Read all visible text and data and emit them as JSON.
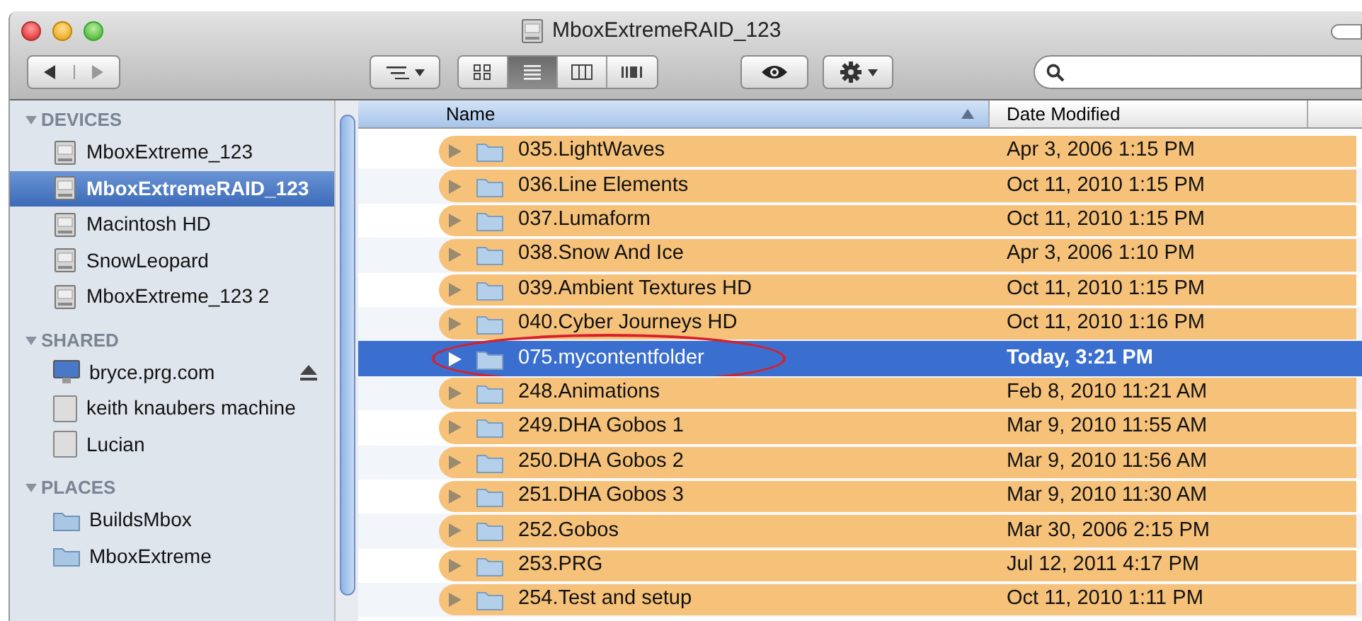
{
  "window": {
    "title": "MboxExtremeRAID_123"
  },
  "toolbar": {
    "view_modes": [
      {
        "kind": "icons",
        "selected": false
      },
      {
        "kind": "list",
        "selected": true
      },
      {
        "kind": "columns",
        "selected": false
      },
      {
        "kind": "coverflow",
        "selected": false
      }
    ]
  },
  "sidebar": {
    "sections": [
      {
        "title": "DEVICES",
        "expanded": true,
        "items": [
          {
            "label": "MboxExtreme_123",
            "kind": "drive",
            "selected": false,
            "eject": false
          },
          {
            "label": "MboxExtremeRAID_123",
            "kind": "drive",
            "selected": true,
            "eject": false
          },
          {
            "label": "Macintosh HD",
            "kind": "drive",
            "selected": false,
            "eject": false
          },
          {
            "label": "SnowLeopard",
            "kind": "drive",
            "selected": false,
            "eject": false
          },
          {
            "label": "MboxExtreme_123 2",
            "kind": "drive",
            "selected": false,
            "eject": false
          }
        ]
      },
      {
        "title": "SHARED",
        "expanded": true,
        "items": [
          {
            "label": "bryce.prg.com",
            "kind": "display",
            "selected": false,
            "eject": true
          },
          {
            "label": "keith knaubers machine",
            "kind": "computer",
            "selected": false,
            "eject": false
          },
          {
            "label": "Lucian",
            "kind": "computer",
            "selected": false,
            "eject": false
          }
        ]
      },
      {
        "title": "PLACES",
        "expanded": true,
        "items": [
          {
            "label": "BuildsMbox",
            "kind": "folder",
            "selected": false,
            "eject": false
          },
          {
            "label": "MboxExtreme",
            "kind": "folder",
            "selected": false,
            "eject": false
          }
        ]
      }
    ]
  },
  "table": {
    "columns": [
      {
        "label": "Name",
        "sorted": true
      },
      {
        "label": "Date Modified",
        "sorted": false
      }
    ],
    "rows": [
      {
        "name": "035.LightWaves",
        "date": "Apr 3, 2006 1:15 PM",
        "selected": false,
        "circled": false,
        "color": "#f6c27a"
      },
      {
        "name": "036.Line Elements",
        "date": "Oct 11, 2010 1:15 PM",
        "selected": false,
        "circled": false,
        "color": "#f6c27a"
      },
      {
        "name": "037.Lumaform",
        "date": "Oct 11, 2010 1:15 PM",
        "selected": false,
        "circled": false,
        "color": "#f6c27a"
      },
      {
        "name": "038.Snow And Ice",
        "date": "Apr 3, 2006 1:10 PM",
        "selected": false,
        "circled": false,
        "color": "#f6c27a"
      },
      {
        "name": "039.Ambient Textures HD",
        "date": "Oct 11, 2010 1:15 PM",
        "selected": false,
        "circled": false,
        "color": "#f6c27a"
      },
      {
        "name": "040.Cyber Journeys HD",
        "date": "Oct 11, 2010 1:16 PM",
        "selected": false,
        "circled": false,
        "color": "#f6c27a"
      },
      {
        "name": "075.mycontentfolder",
        "date": "Today, 3:21 PM",
        "selected": true,
        "circled": true
      },
      {
        "name": "248.Animations",
        "date": "Feb 8, 2010 11:21 AM",
        "selected": false,
        "circled": false,
        "color": "#f6c27a"
      },
      {
        "name": "249.DHA Gobos 1",
        "date": "Mar 9, 2010 11:55 AM",
        "selected": false,
        "circled": false,
        "color": "#f6c27a"
      },
      {
        "name": "250.DHA Gobos 2",
        "date": "Mar 9, 2010 11:56 AM",
        "selected": false,
        "circled": false,
        "color": "#f6c27a"
      },
      {
        "name": "251.DHA Gobos 3",
        "date": "Mar 9, 2010 11:30 AM",
        "selected": false,
        "circled": false,
        "color": "#f6c27a"
      },
      {
        "name": "252.Gobos",
        "date": "Mar 30, 2006 2:15 PM",
        "selected": false,
        "circled": false,
        "color": "#f6c27a"
      },
      {
        "name": "253.PRG",
        "date": "Jul 12, 2011 4:17 PM",
        "selected": false,
        "circled": false,
        "color": "#f6c27a"
      },
      {
        "name": "254.Test and setup",
        "date": "Oct 11, 2010 1:11 PM",
        "selected": false,
        "circled": false,
        "color": "#f6c27a"
      }
    ]
  }
}
